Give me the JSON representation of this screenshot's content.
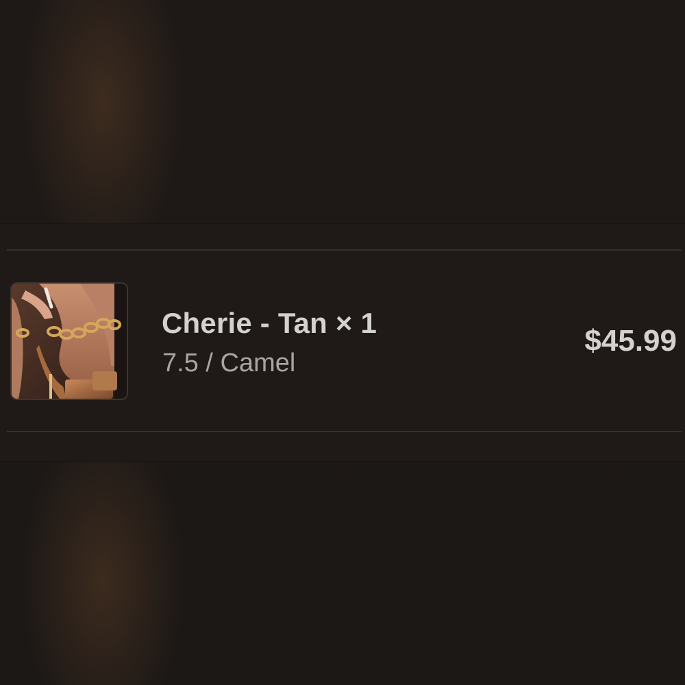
{
  "line_item": {
    "image_icon": "product-photo-heels-with-chain-anklet",
    "title": "Cherie - Tan × 1",
    "variant": "7.5 / Camel",
    "price": "$45.99"
  },
  "colors": {
    "background": "#1d1816",
    "card": "#1f1a18",
    "divider": "#36302c",
    "title_text": "#d4d2d0",
    "variant_text": "#a8a5a2"
  }
}
